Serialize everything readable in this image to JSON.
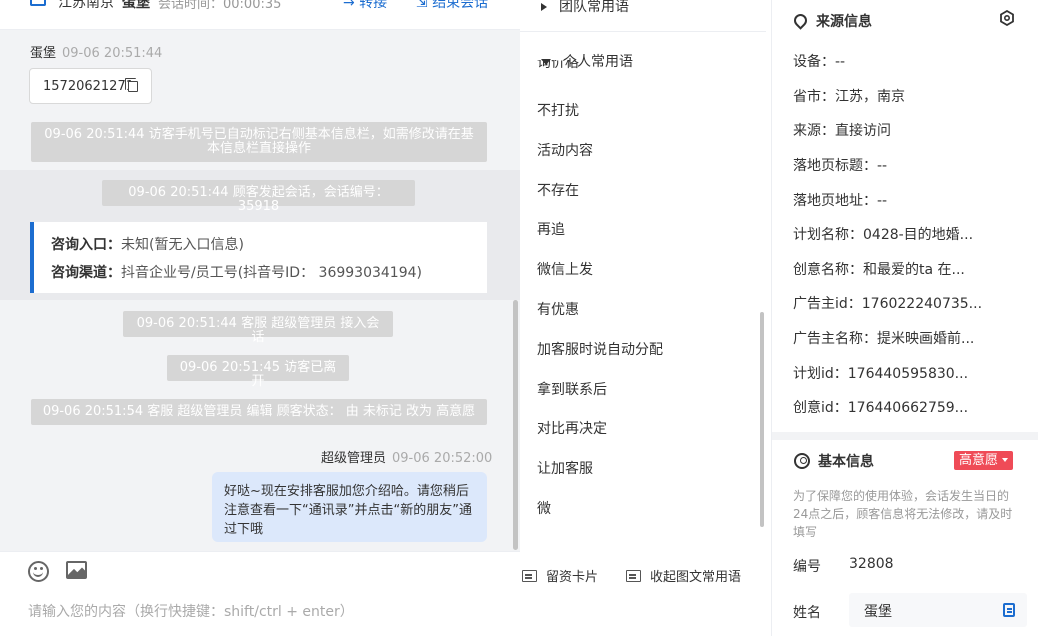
{
  "header": {
    "region": "江苏南京",
    "visitor_name": "蛋堡",
    "session_time_label": "会话时间：00:00:35",
    "transfer_label": "→ 转接",
    "end_label": "结束会话"
  },
  "chat": {
    "visitor_msg": {
      "sender": "蛋堡",
      "time": "09-06 20:51:44",
      "phone": "15720621271"
    },
    "system_messages": [
      "09-06 20:51:44 访客手机号已自动标记右侧基本信息栏，如需修改请在基本信息栏直接操作",
      "09-06 20:51:44 顾客发起会话，会话编号：35918",
      "09-06 20:51:44 客服 超级管理员 接入会话",
      "09-06 20:51:45 访客已离开",
      "09-06 20:51:54 客服 超级管理员 编辑 顾客状态： 由 未标记 改为 高意愿"
    ],
    "consult_card": {
      "entry_label": "咨询入口：",
      "entry_value": "未知(暂无入口信息)",
      "channel_label": "咨询渠道：",
      "channel_value": "抖音企业号/员工号(抖音号ID： 36993034194)"
    },
    "agent_msg": {
      "sender": "超级管理员",
      "time": "09-06 20:52:00",
      "text": "好哒~现在安排客服加您介绍哈。请您稍后注意查看一下“通讯录”并点击“新的朋友”通过下哦"
    }
  },
  "composer": {
    "placeholder": "请输入您的内容（换行快捷键：shift/ctrl + enter）"
  },
  "phrases": {
    "team_group": "团队常用语",
    "personal_group": "个人常用语",
    "cut_item": "询价格",
    "items": [
      "不打扰",
      "活动内容",
      "不存在",
      "再追",
      "微信上发",
      "有优惠",
      "加客服时说自动分配",
      "拿到联系后",
      "对比再决定",
      "让加客服",
      "微"
    ],
    "card_action": "留资卡片",
    "collapse_action": "收起图文常用语"
  },
  "source_info": {
    "title": "来源信息",
    "rows": [
      "设备：--",
      "省市：江苏，南京",
      "来源：直接访问",
      "落地页标题：--",
      "落地页地址：--",
      "计划名称：0428-目的地婚...",
      "创意名称：和最爱的ta 在...",
      "广告主id：176022240735...",
      "广告主名称：提米映画婚前...",
      "计划id：176440595830...",
      "创意id：176440662759..."
    ]
  },
  "basic_info": {
    "title": "基本信息",
    "intent_tag": "高意愿",
    "note": "为了保障您的使用体验，会话发生当日的24点之后，顾客信息将无法修改，请及时填写",
    "id_label": "编号",
    "id_value": "32808",
    "name_label": "姓名",
    "name_value": "蛋堡"
  },
  "colors": {
    "accent": "#1c6dd0",
    "tag_red": "#ef4b57",
    "agent_bubble": "#dce8fb"
  }
}
